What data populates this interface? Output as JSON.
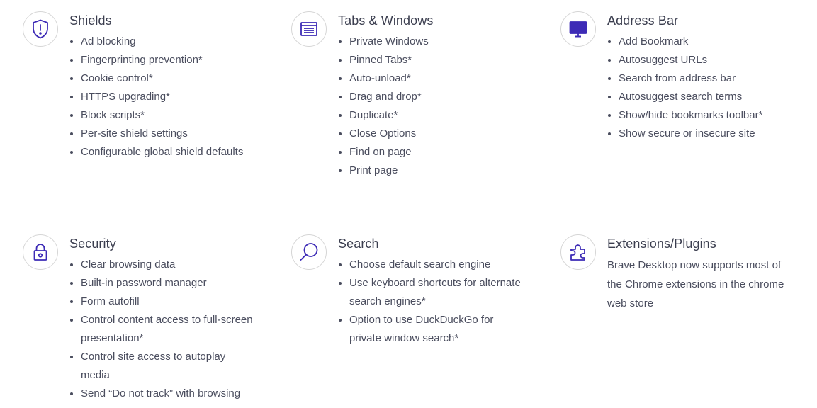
{
  "colors": {
    "icon_stroke": "#3d2bb6",
    "icon_circle_border": "#d6d6d6",
    "title": "#3b3e4f",
    "text": "#4a4d5e"
  },
  "shields": {
    "icon": "shield-icon",
    "title": "Shields",
    "items": [
      "Ad blocking",
      "Fingerprinting prevention*",
      "Cookie control*",
      "HTTPS upgrading*",
      "Block scripts*",
      "Per-site shield settings",
      "Configurable global shield defaults"
    ]
  },
  "tabs": {
    "icon": "browser-window-icon",
    "title": "Tabs & Windows",
    "items": [
      "Private Windows",
      "Pinned Tabs*",
      "Auto-unload*",
      "Drag and drop*",
      "Duplicate*",
      "Close Options",
      "Find on page",
      "Print page"
    ]
  },
  "address_bar": {
    "icon": "monitor-icon",
    "title": "Address Bar",
    "items": [
      "Add Bookmark",
      "Autosuggest URLs",
      "Search from address bar",
      "Autosuggest search terms",
      "Show/hide bookmarks toolbar*",
      "Show secure or insecure site"
    ]
  },
  "security": {
    "icon": "lock-icon",
    "title": "Security",
    "items": [
      "Clear browsing data",
      "Built-in password manager",
      "Form autofill",
      "Control content access to full-screen presentation*",
      "Control site access to autoplay media",
      "Send “Do not track” with browsing requests*"
    ]
  },
  "search": {
    "icon": "magnifier-icon",
    "title": "Search",
    "items": [
      "Choose default search engine",
      "Use keyboard shortcuts for alternate search engines*",
      "Option to use DuckDuckGo for private window search*"
    ]
  },
  "extensions": {
    "icon": "puzzle-piece-icon",
    "title": "Extensions/Plugins",
    "description": "Brave Desktop now supports most of the Chrome extensions in the chrome web store"
  }
}
